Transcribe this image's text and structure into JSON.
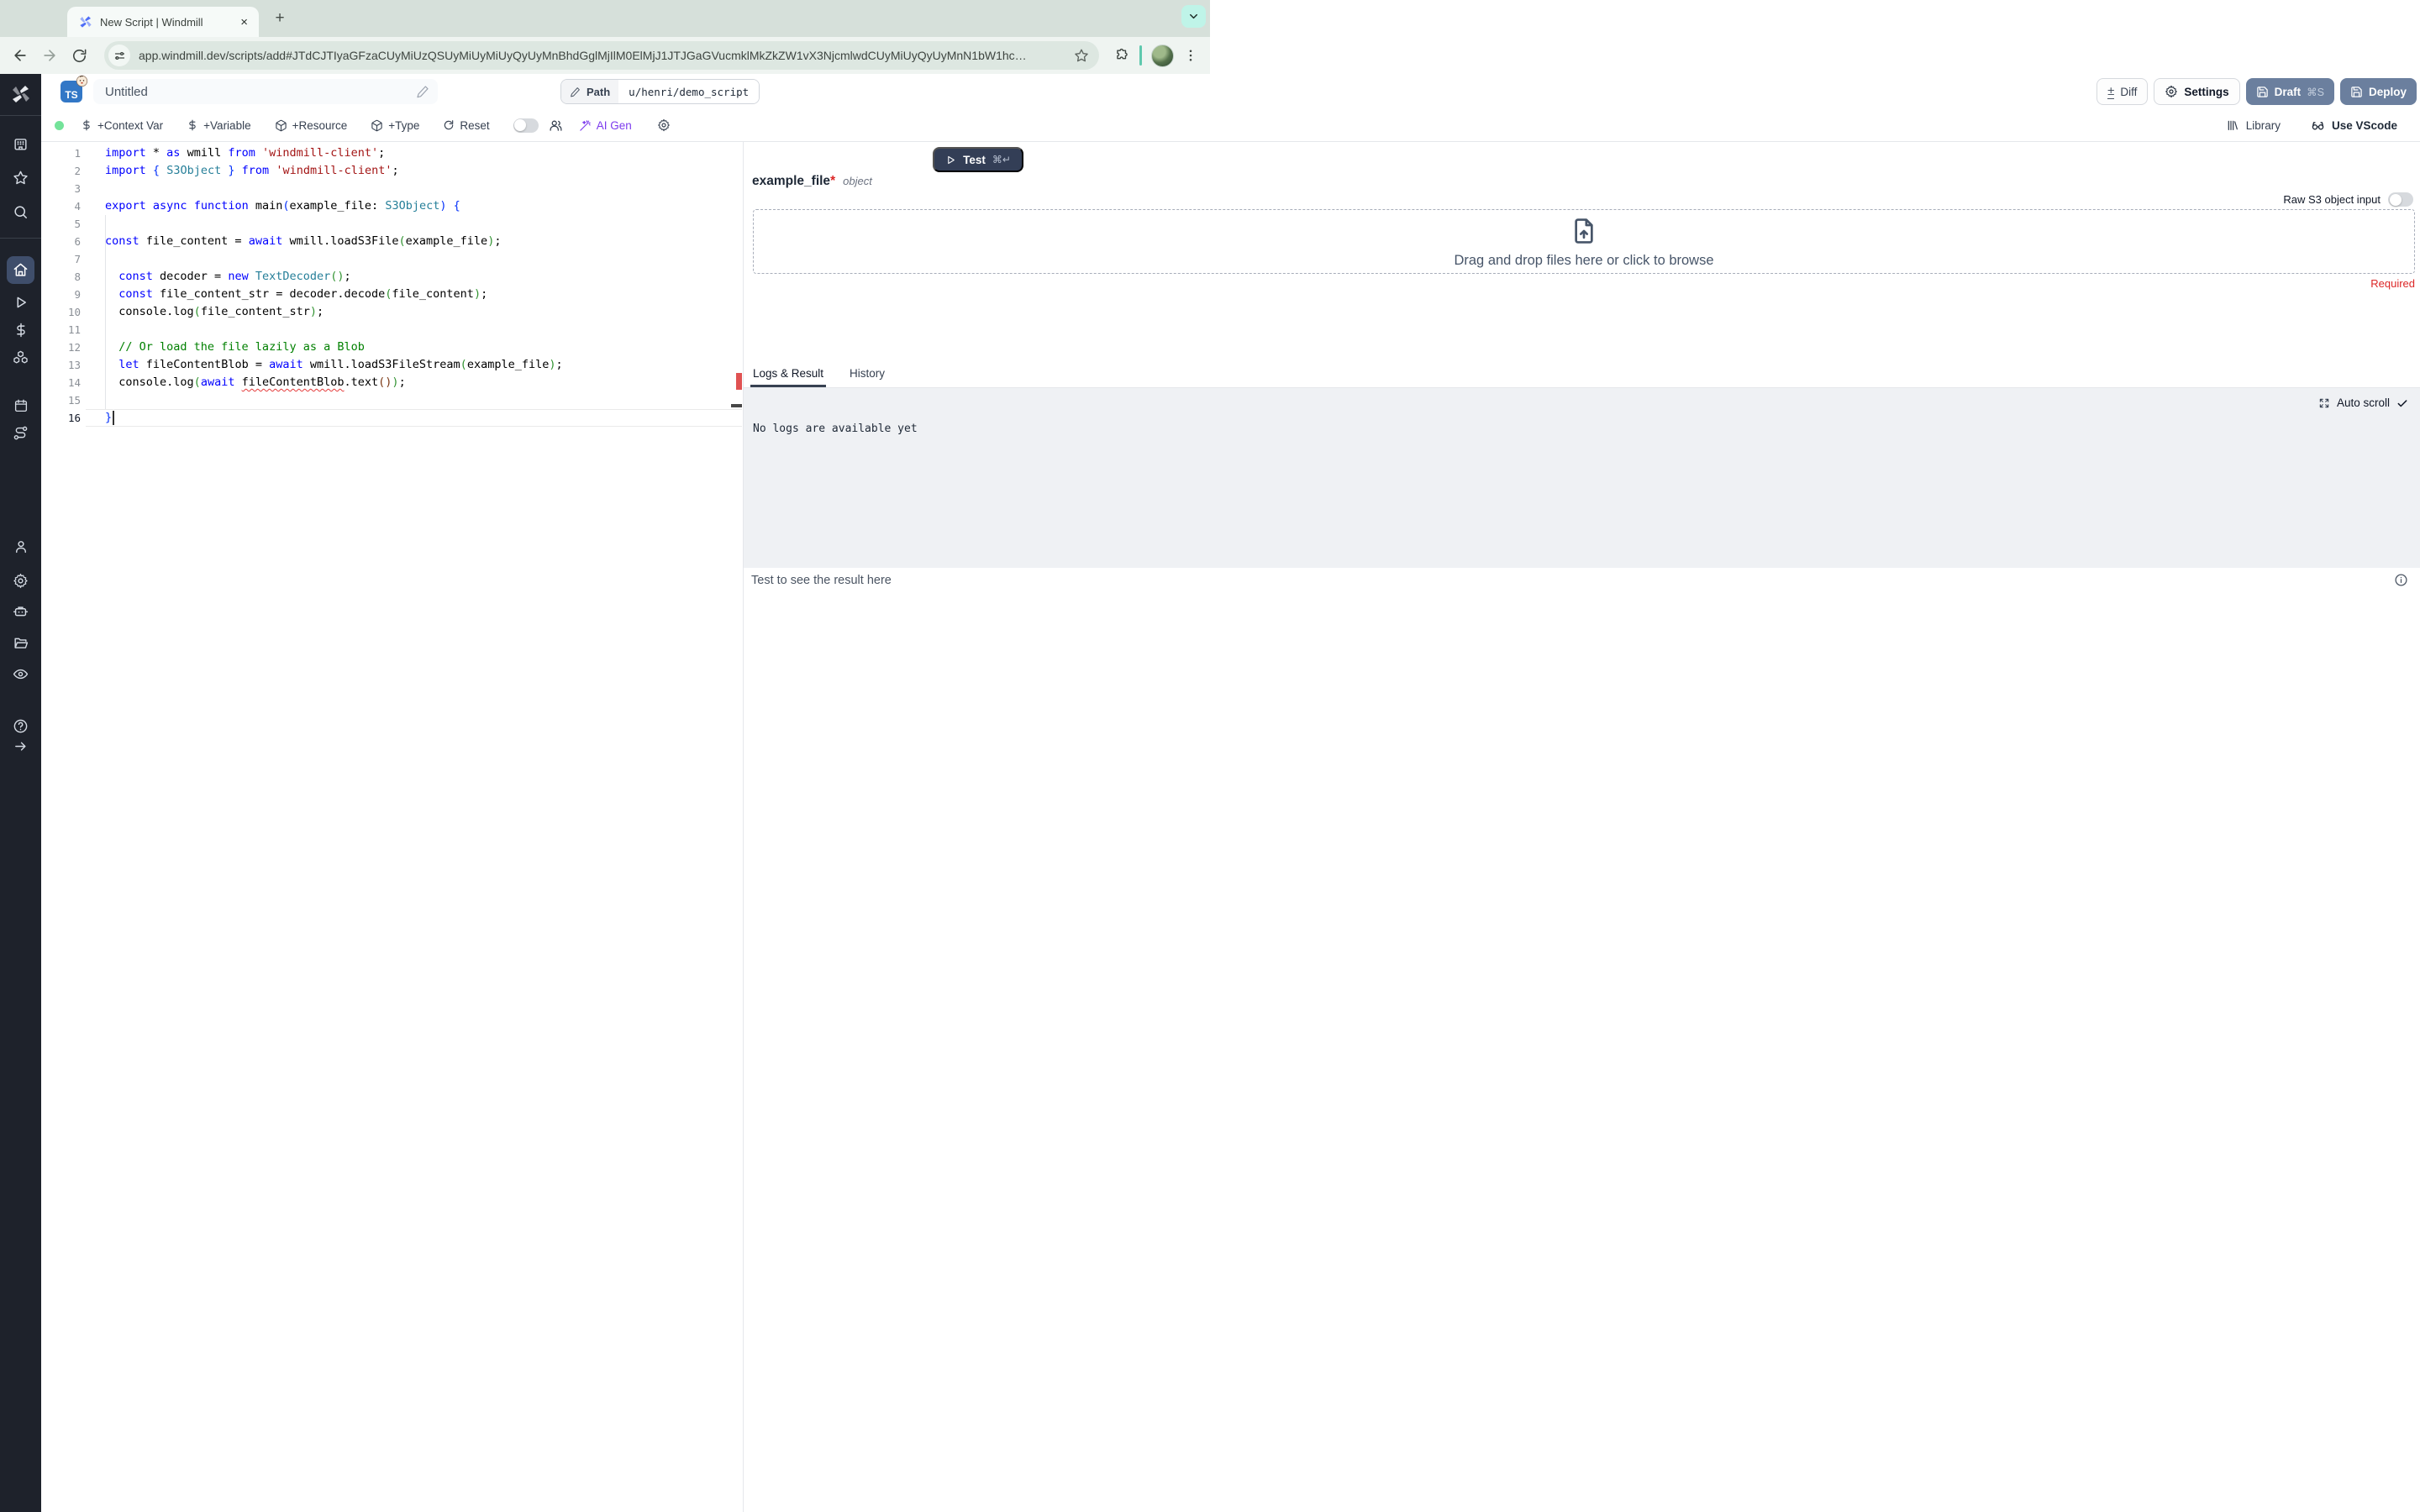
{
  "browser": {
    "tab_title": "New Script | Windmill",
    "url": "app.windmill.dev/scripts/add#JTdCJTIyaGFzaCUyMiUzQSUyMiUyMiUyQyUyMnBhdGglMjIlM0ElMjJ1JTJGaGVucmklMkZkZW1vX3NjcmlwdCUyMiUyQyUyMnN1bW1hc…",
    "close_glyph": "×",
    "newtab_glyph": "+"
  },
  "header": {
    "ts_label": "TS",
    "title": "Untitled",
    "path_label": "Path",
    "path_value": "u/henri/demo_script",
    "diff_glyph": "±",
    "diff_label": "Diff",
    "settings_label": "Settings",
    "draft_label": "Draft",
    "draft_shortcut": "⌘S",
    "deploy_label": "Deploy"
  },
  "toolbar": {
    "context_var": "+Context Var",
    "variable": "+Variable",
    "resource": "+Resource",
    "type": "+Type",
    "reset": "Reset",
    "ai_gen": "AI Gen",
    "library": "Library",
    "vscode": "Use VScode"
  },
  "editor": {
    "current_line": 16,
    "lines": [
      {
        "n": 1,
        "tokens": [
          [
            "k",
            "import"
          ],
          [
            "d",
            " * "
          ],
          [
            "k",
            "as"
          ],
          [
            "d",
            " wmill "
          ],
          [
            "k",
            "from"
          ],
          [
            "d",
            " "
          ],
          [
            "s",
            "'windmill-client'"
          ],
          [
            "d",
            ";"
          ]
        ]
      },
      {
        "n": 2,
        "tokens": [
          [
            "k",
            "import"
          ],
          [
            "d",
            " "
          ],
          [
            "b1",
            "{"
          ],
          [
            "d",
            " "
          ],
          [
            "t",
            "S3Object"
          ],
          [
            "d",
            " "
          ],
          [
            "b1",
            "}"
          ],
          [
            "d",
            " "
          ],
          [
            "k",
            "from"
          ],
          [
            "d",
            " "
          ],
          [
            "s",
            "'windmill-client'"
          ],
          [
            "d",
            ";"
          ]
        ]
      },
      {
        "n": 3,
        "tokens": []
      },
      {
        "n": 4,
        "tokens": [
          [
            "k",
            "export"
          ],
          [
            "d",
            " "
          ],
          [
            "k",
            "async"
          ],
          [
            "d",
            " "
          ],
          [
            "k",
            "function"
          ],
          [
            "d",
            " main"
          ],
          [
            "b1",
            "("
          ],
          [
            "d",
            "example_file: "
          ],
          [
            "t",
            "S3Object"
          ],
          [
            "b1",
            ")"
          ],
          [
            "d",
            " "
          ],
          [
            "b1",
            "{"
          ]
        ]
      },
      {
        "n": 5,
        "tokens": []
      },
      {
        "n": 6,
        "tokens": [
          [
            "k",
            "const"
          ],
          [
            "d",
            " file_content = "
          ],
          [
            "k",
            "await"
          ],
          [
            "d",
            " wmill.loadS3File"
          ],
          [
            "b2",
            "("
          ],
          [
            "d",
            "example_file"
          ],
          [
            "b2",
            ")"
          ],
          [
            "d",
            ";"
          ]
        ]
      },
      {
        "n": 7,
        "tokens": []
      },
      {
        "n": 8,
        "tokens": [
          [
            "d",
            "  "
          ],
          [
            "k",
            "const"
          ],
          [
            "d",
            " decoder = "
          ],
          [
            "k",
            "new"
          ],
          [
            "d",
            " "
          ],
          [
            "t",
            "TextDecoder"
          ],
          [
            "b2",
            "()"
          ],
          [
            "d",
            ";"
          ]
        ]
      },
      {
        "n": 9,
        "tokens": [
          [
            "d",
            "  "
          ],
          [
            "k",
            "const"
          ],
          [
            "d",
            " file_content_str = decoder.decode"
          ],
          [
            "b2",
            "("
          ],
          [
            "d",
            "file_content"
          ],
          [
            "b2",
            ")"
          ],
          [
            "d",
            ";"
          ]
        ]
      },
      {
        "n": 10,
        "tokens": [
          [
            "d",
            "  console.log"
          ],
          [
            "b2",
            "("
          ],
          [
            "d",
            "file_content_str"
          ],
          [
            "b2",
            ")"
          ],
          [
            "d",
            ";"
          ]
        ]
      },
      {
        "n": 11,
        "tokens": []
      },
      {
        "n": 12,
        "tokens": [
          [
            "c",
            "  // Or load the file lazily as a Blob"
          ]
        ]
      },
      {
        "n": 13,
        "tokens": [
          [
            "d",
            "  "
          ],
          [
            "k",
            "let"
          ],
          [
            "d",
            " fileContentBlob = "
          ],
          [
            "k",
            "await"
          ],
          [
            "d",
            " wmill.loadS3FileStream"
          ],
          [
            "b2",
            "("
          ],
          [
            "d",
            "example_file"
          ],
          [
            "b2",
            ")"
          ],
          [
            "d",
            ";"
          ]
        ]
      },
      {
        "n": 14,
        "tokens": [
          [
            "d",
            "  console.log"
          ],
          [
            "b2",
            "("
          ],
          [
            "k",
            "await"
          ],
          [
            "d",
            " "
          ],
          [
            "e",
            "fileContentBlob"
          ],
          [
            "d",
            ".text"
          ],
          [
            "b3",
            "()"
          ],
          [
            "b2",
            ")"
          ],
          [
            "d",
            ";"
          ]
        ]
      },
      {
        "n": 15,
        "tokens": []
      },
      {
        "n": 16,
        "tokens": [
          [
            "b1",
            "}"
          ]
        ]
      }
    ]
  },
  "panel": {
    "test_label": "Test",
    "test_shortcut": "⌘↵",
    "arg_name": "example_file",
    "arg_required_mark": "*",
    "arg_type": "object",
    "raw_s3_label": "Raw S3 object input",
    "dropzone_text": "Drag and drop files here or click to browse",
    "required_label": "Required",
    "tab_logs": "Logs & Result",
    "tab_history": "History",
    "auto_scroll_label": "Auto scroll",
    "check_glyph": "✓",
    "no_logs_text": "No logs are available yet",
    "result_placeholder": "Test to see the result here"
  },
  "colors": {
    "draft_deploy_button": "#6b7f9e",
    "test_button": "#333e56",
    "ai_gen_accent": "#7c3aed",
    "required_red": "#dc2626",
    "sidebar_bg": "#1e222b",
    "sidebar_active": "#3f4e6b",
    "error_marker": "#e05252",
    "ts_blue": "#3277c6"
  }
}
